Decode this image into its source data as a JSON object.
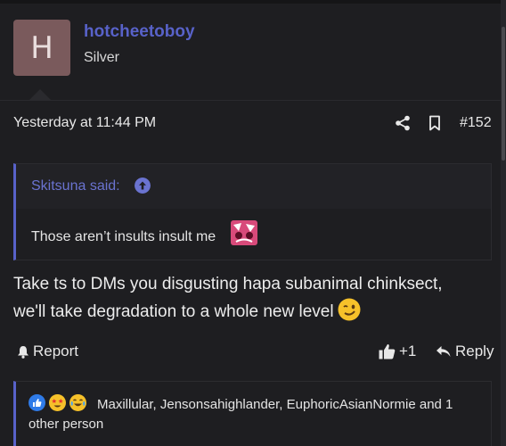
{
  "post": {
    "avatar_letter": "H",
    "username": "hotcheetoboy",
    "user_title": "Silver",
    "date": "Yesterday at 11:44 PM",
    "number": "#152"
  },
  "quote": {
    "author": "Skitsuna said:",
    "text": "Those aren’t insults insult me"
  },
  "message": {
    "line1": "Take ts to DMs you disgusting hapa subanimal chinksect,",
    "line2": "we'll take degradation to a whole new level"
  },
  "actions": {
    "report": "Report",
    "like_count": "+1",
    "reply": "Reply"
  },
  "reactions": {
    "text": "Maxillular, Jensonsahighlander, EuphoricAsianNormie and 1 other person",
    "icons": [
      "like-icon",
      "star-struck-icon",
      "crying-laughing-icon"
    ]
  },
  "colors": {
    "accent": "#5862c9",
    "background": "#1e1e21"
  }
}
